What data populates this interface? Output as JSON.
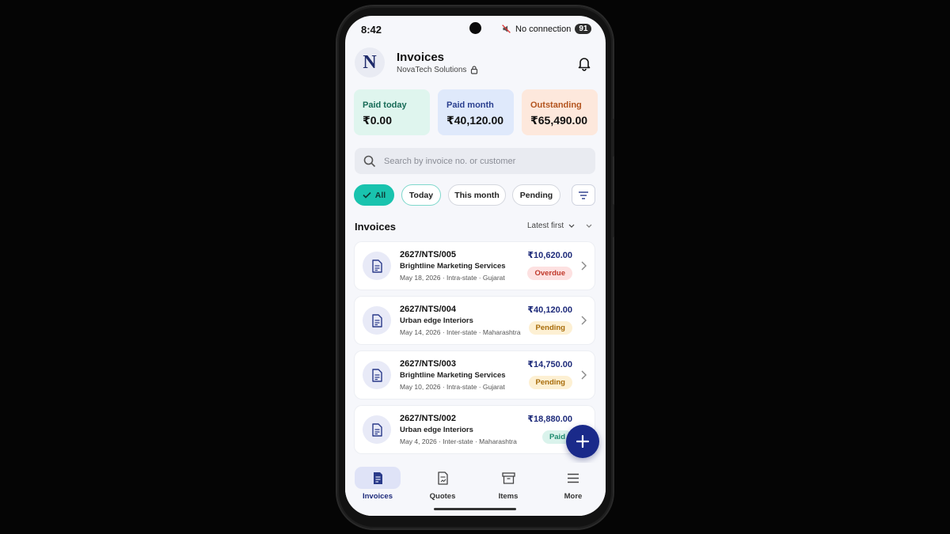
{
  "status_bar": {
    "time": "8:42",
    "connection": "No connection",
    "battery": "91"
  },
  "header": {
    "logo_letter": "N",
    "title": "Invoices",
    "company": "NovaTech Solutions"
  },
  "summary": [
    {
      "label": "Paid today",
      "value": "₹0.00",
      "bg": "#dff5ee",
      "label_color": "#176b57"
    },
    {
      "label": "Paid month",
      "value": "₹40,120.00",
      "bg": "#dfe9fb",
      "label_color": "#2a3f8f"
    },
    {
      "label": "Outstanding",
      "value": "₹65,490.00",
      "bg": "#fde8dc",
      "label_color": "#b3541e"
    }
  ],
  "search": {
    "placeholder": "Search by invoice no. or customer"
  },
  "filters": {
    "all": "All",
    "today": "Today",
    "this_month": "This month",
    "pending": "Pending"
  },
  "list": {
    "title": "Invoices",
    "sort_label": "Latest first"
  },
  "invoices": [
    {
      "number": "2627/NTS/005",
      "customer": "Brightline Marketing Services",
      "meta": "May 18, 2026 · Intra-state · Gujarat",
      "amount": "₹10,620.00",
      "status": "Overdue"
    },
    {
      "number": "2627/NTS/004",
      "customer": "Urban edge Interiors",
      "meta": "May 14, 2026 · Inter-state · Maharashtra",
      "amount": "₹40,120.00",
      "status": "Pending"
    },
    {
      "number": "2627/NTS/003",
      "customer": "Brightline Marketing Services",
      "meta": "May 10, 2026 · Intra-state · Gujarat",
      "amount": "₹14,750.00",
      "status": "Pending"
    },
    {
      "number": "2627/NTS/002",
      "customer": "Urban edge Interiors",
      "meta": "May 4, 2026 · Inter-state · Maharashtra",
      "amount": "₹18,880.00",
      "status": "Paid"
    }
  ],
  "nav": {
    "invoices": "Invoices",
    "quotes": "Quotes",
    "items": "Items",
    "more": "More"
  },
  "colors": {
    "accent": "#19c3ae",
    "primary": "#1a2a8a"
  },
  "icons": [
    "bell-icon",
    "lock-icon",
    "search-icon",
    "check-icon",
    "filter-icon",
    "document-icon",
    "chevron-right-icon",
    "plus-icon",
    "quote-icon",
    "box-icon",
    "menu-icon"
  ]
}
